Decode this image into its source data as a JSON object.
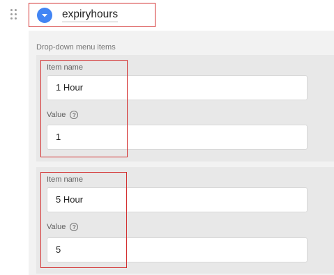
{
  "variable": {
    "name": "expiryhours",
    "chevron_icon": "chevron-down-icon",
    "handle_icon": "drag-handle-icon"
  },
  "section_label": "Drop-down menu items",
  "items": [
    {
      "name_label": "Item name",
      "name_value": "1 Hour",
      "value_label": "Value",
      "value_value": "1"
    },
    {
      "name_label": "Item name",
      "name_value": "5 Hour",
      "value_label": "Value",
      "value_value": "5"
    }
  ],
  "help_glyph": "?",
  "colors": {
    "accent": "#4285f4",
    "highlight": "#d32f2f",
    "panel": "#e8e8e8"
  }
}
